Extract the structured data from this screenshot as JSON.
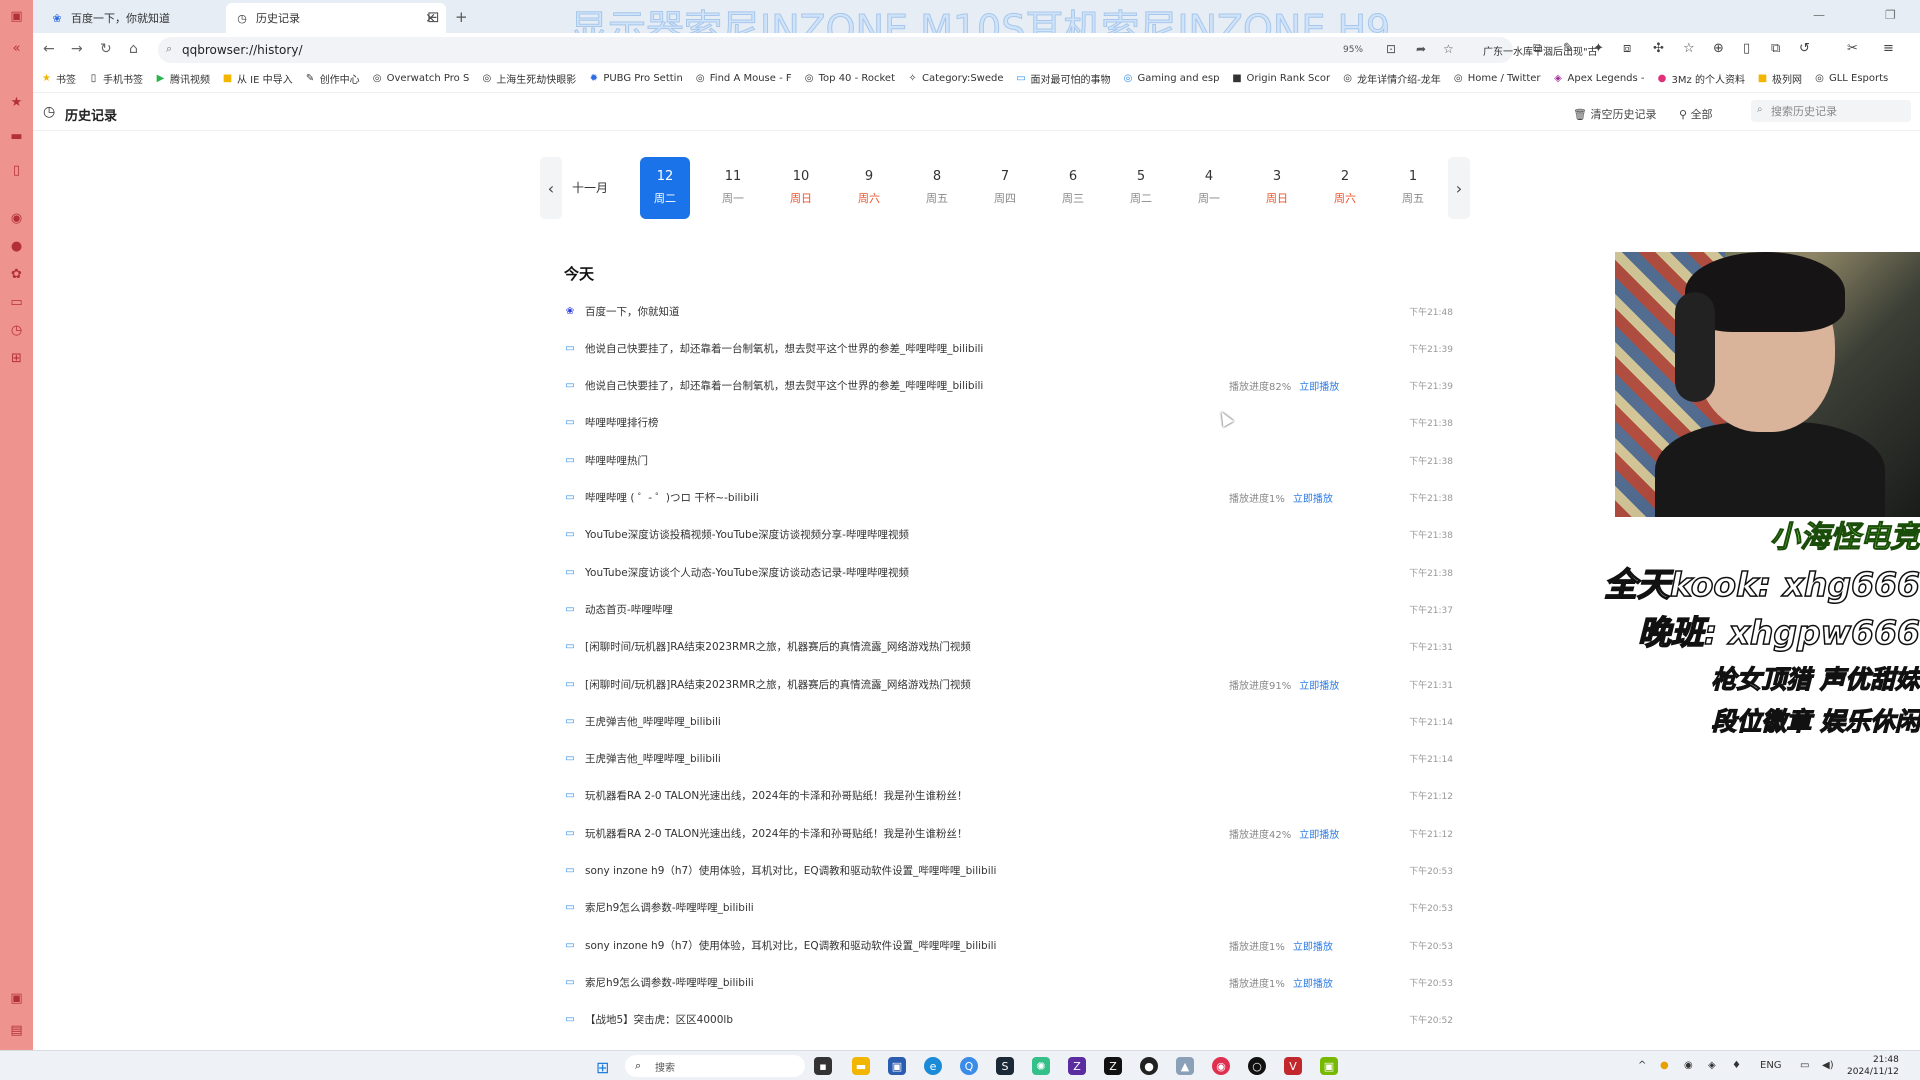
{
  "overlay_title": "显示器索尼INZONE M10S耳机索尼INZONE H9",
  "tabs": [
    {
      "label": "百度一下，你就知道",
      "icon": "baidu-icon"
    },
    {
      "label": "历史记录",
      "icon": "clock-icon"
    }
  ],
  "address": {
    "url": "qqbrowser://history/",
    "zoom": "95%",
    "hot_search": "广东一水库干涸后出现\"古"
  },
  "bookmarks": [
    "书签",
    "手机书签",
    "腾讯视频",
    "从 IE 中导入",
    "创作中心",
    "Overwatch Pro S",
    "上海生死劫快眼影",
    "PUBG Pro Settin",
    "Find A Mouse - F",
    "Top 40 - Rocket",
    "Category:Swede",
    "面对最可怕的事物",
    "Gaming and esp",
    "Origin Rank Scor",
    "龙年详情介绍-龙年",
    "Home / Twitter",
    "Apex Legends -",
    "3Mz 的个人资料",
    "极列网",
    "GLL Esports"
  ],
  "history_header": {
    "title": "历史记录",
    "clear_label": "清空历史记录",
    "filter_label": "全部",
    "search_placeholder": "搜索历史记录"
  },
  "date_strip": {
    "month": "十一月",
    "days": [
      {
        "num": "12",
        "week": "周二",
        "active": true,
        "weekend": false
      },
      {
        "num": "11",
        "week": "周一",
        "active": false,
        "weekend": false
      },
      {
        "num": "10",
        "week": "周日",
        "active": false,
        "weekend": true
      },
      {
        "num": "9",
        "week": "周六",
        "active": false,
        "weekend": true
      },
      {
        "num": "8",
        "week": "周五",
        "active": false,
        "weekend": false
      },
      {
        "num": "7",
        "week": "周四",
        "active": false,
        "weekend": false
      },
      {
        "num": "6",
        "week": "周三",
        "active": false,
        "weekend": false
      },
      {
        "num": "5",
        "week": "周二",
        "active": false,
        "weekend": false
      },
      {
        "num": "4",
        "week": "周一",
        "active": false,
        "weekend": false
      },
      {
        "num": "3",
        "week": "周日",
        "active": false,
        "weekend": true
      },
      {
        "num": "2",
        "week": "周六",
        "active": false,
        "weekend": true
      },
      {
        "num": "1",
        "week": "周五",
        "active": false,
        "weekend": false
      }
    ]
  },
  "section_title": "今天",
  "play_label": "立即播放",
  "history": [
    {
      "title": "百度一下，你就知道",
      "time": "下午21:48",
      "progress": "",
      "icon": "baidu-icon"
    },
    {
      "title": "他说自己快要挂了，却还靠着一台制氧机，想去熨平这个世界的参差_哔哩哔哩_bilibili",
      "time": "下午21:39",
      "progress": "",
      "icon": "bilibili-icon"
    },
    {
      "title": "他说自己快要挂了，却还靠着一台制氧机，想去熨平这个世界的参差_哔哩哔哩_bilibili",
      "time": "下午21:39",
      "progress": "播放进度82%",
      "icon": "bilibili-icon"
    },
    {
      "title": "哔哩哔哩排行榜",
      "time": "下午21:38",
      "progress": "",
      "icon": "bilibili-icon"
    },
    {
      "title": "哔哩哔哩热门",
      "time": "下午21:38",
      "progress": "",
      "icon": "bilibili-icon"
    },
    {
      "title": "哔哩哔哩 ( ゜- ゜)つロ 干杯~-bilibili",
      "time": "下午21:38",
      "progress": "播放进度1%",
      "icon": "bilibili-icon"
    },
    {
      "title": "YouTube深度访谈投稿视频-YouTube深度访谈视频分享-哔哩哔哩视频",
      "time": "下午21:38",
      "progress": "",
      "icon": "bilibili-icon"
    },
    {
      "title": "YouTube深度访谈个人动态-YouTube深度访谈动态记录-哔哩哔哩视频",
      "time": "下午21:38",
      "progress": "",
      "icon": "bilibili-icon"
    },
    {
      "title": "动态首页-哔哩哔哩",
      "time": "下午21:37",
      "progress": "",
      "icon": "bilibili-icon"
    },
    {
      "title": "[闲聊时间/玩机器]RA结束2023RMR之旅，机器赛后的真情流露_网络游戏热门视频",
      "time": "下午21:31",
      "progress": "",
      "icon": "bilibili-icon"
    },
    {
      "title": "[闲聊时间/玩机器]RA结束2023RMR之旅，机器赛后的真情流露_网络游戏热门视频",
      "time": "下午21:31",
      "progress": "播放进度91%",
      "icon": "bilibili-icon"
    },
    {
      "title": "王虎弹吉他_哔哩哔哩_bilibili",
      "time": "下午21:14",
      "progress": "",
      "icon": "bilibili-icon"
    },
    {
      "title": "王虎弹吉他_哔哩哔哩_bilibili",
      "time": "下午21:14",
      "progress": "",
      "icon": "bilibili-icon"
    },
    {
      "title": "玩机器看RA 2-0 TALON光速出线，2024年的卡泽和孙哥贴纸！我是孙生谁粉丝！",
      "time": "下午21:12",
      "progress": "",
      "icon": "bilibili-icon"
    },
    {
      "title": "玩机器看RA 2-0 TALON光速出线，2024年的卡泽和孙哥贴纸！我是孙生谁粉丝！",
      "time": "下午21:12",
      "progress": "播放进度42%",
      "icon": "bilibili-icon"
    },
    {
      "title": "sony inzone h9（h7）使用体验，耳机对比，EQ调教和驱动软件设置_哔哩哔哩_bilibili",
      "time": "下午20:53",
      "progress": "",
      "icon": "bilibili-icon"
    },
    {
      "title": "索尼h9怎么调参数-哔哩哔哩_bilibili",
      "time": "下午20:53",
      "progress": "",
      "icon": "bilibili-icon"
    },
    {
      "title": "sony inzone h9（h7）使用体验，耳机对比，EQ调教和驱动软件设置_哔哩哔哩_bilibili",
      "time": "下午20:53",
      "progress": "播放进度1%",
      "icon": "bilibili-icon"
    },
    {
      "title": "索尼h9怎么调参数-哔哩哔哩_bilibili",
      "time": "下午20:53",
      "progress": "播放进度1%",
      "icon": "bilibili-icon"
    },
    {
      "title": "【战地5】突击虎：区区4000lb",
      "time": "下午20:52",
      "progress": "",
      "icon": "bilibili-icon"
    }
  ],
  "streamer": {
    "line1": "小海怪电竞",
    "line2": "全天kook: xhg666",
    "line3": "晚班: xhgpw666",
    "line4": "枪女顶猎 声优甜妹",
    "line5": "段位徽章 娱乐休闲"
  },
  "taskbar": {
    "search_placeholder": "搜索",
    "lang": "ENG",
    "time": "21:48",
    "date": "2024/11/12"
  },
  "colors": {
    "accent": "#1a73e8",
    "dock": "#ef938f",
    "weekend": "#e8552c",
    "link": "#2d7be5"
  }
}
